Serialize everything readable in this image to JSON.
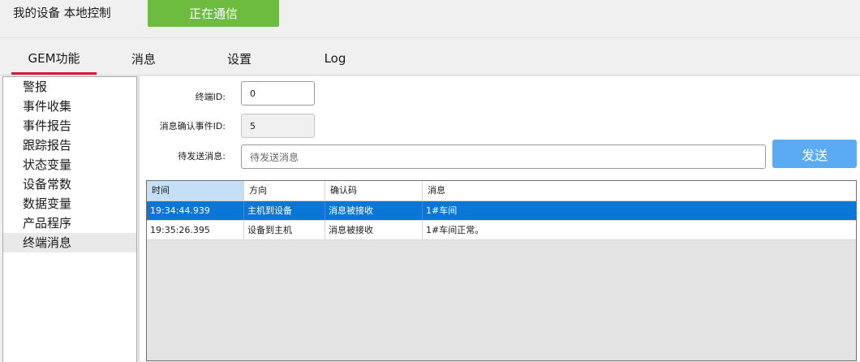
{
  "header": {
    "title": "我的设备 本地控制",
    "status_button": "正在通信",
    "status_color": "#6dbc3f"
  },
  "tabs": [
    {
      "label": "GEM功能",
      "active": true
    },
    {
      "label": "消息",
      "active": false
    },
    {
      "label": "设置",
      "active": false
    },
    {
      "label": "Log",
      "active": false
    }
  ],
  "sidebar": {
    "items": [
      {
        "label": "警报"
      },
      {
        "label": "事件收集"
      },
      {
        "label": "事件报告"
      },
      {
        "label": "跟踪报告"
      },
      {
        "label": "状态变量"
      },
      {
        "label": "设备常数"
      },
      {
        "label": "数据变量"
      },
      {
        "label": "产品程序"
      },
      {
        "label": "终端消息",
        "selected": true
      }
    ]
  },
  "form": {
    "terminal_id_label": "终端ID:",
    "terminal_id_value": "0",
    "ack_event_label": "消息确认事件ID:",
    "ack_event_value": "5",
    "pending_label": "待发送消息:",
    "pending_placeholder": "待发送消息",
    "send_button": "发送",
    "send_color": "#5aabf4"
  },
  "grid": {
    "columns": [
      "时间",
      "方向",
      "确认码",
      "消息"
    ],
    "rows": [
      {
        "time": "19:34:44.939",
        "direction": "主机到设备",
        "ack": "消息被接收",
        "message": "1#车间",
        "selected": true
      },
      {
        "time": "19:35:26.395",
        "direction": "设备到主机",
        "ack": "消息被接收",
        "message": "1#车间正常。",
        "selected": false
      }
    ],
    "selection_color": "#0a77d6"
  }
}
